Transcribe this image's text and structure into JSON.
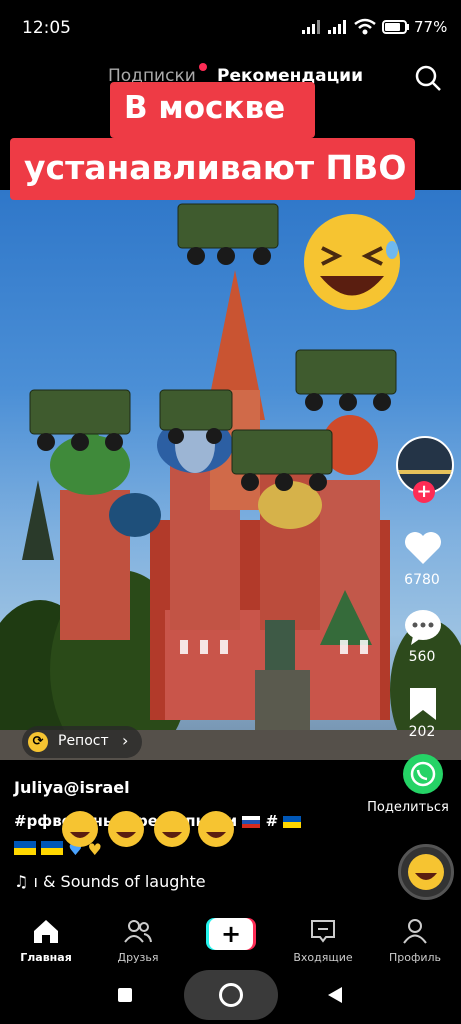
{
  "status_bar": {
    "time": "12:05",
    "battery": "77"
  },
  "top_tabs": {
    "following": "Подписки",
    "for_you": "Рекомендации"
  },
  "caption": {
    "line1": "В москве",
    "line2": "устанавливают ПВО"
  },
  "sidebar": {
    "likes": "6780",
    "comments": "560",
    "bookmarks": "202",
    "share": "Поделиться"
  },
  "repost": {
    "label": "Репост"
  },
  "post": {
    "author": "Juliya@israel",
    "hashtags": "#рфвоенныепреступники",
    "sound": "ı & Sounds of laughte"
  },
  "bottom_nav": {
    "home": "Главная",
    "friends": "Друзья",
    "inbox": "Входящие",
    "profile": "Профиль"
  }
}
